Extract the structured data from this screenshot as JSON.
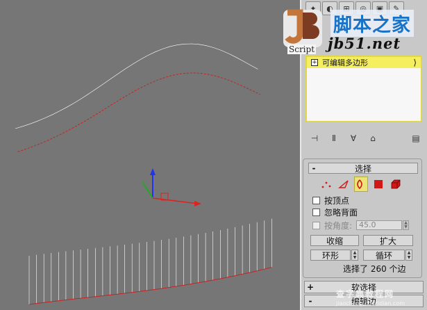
{
  "toolbar_tabs": [
    "create-icon",
    "modify-icon",
    "hierarchy-icon",
    "motion-icon",
    "display-icon",
    "utilities-icon"
  ],
  "logo": {
    "cn_text": "脚本之家",
    "url_text": "jb51.net",
    "script_text": "Script"
  },
  "modifier_stack": {
    "item_label": "可编辑多边形",
    "expand_symbol": "+"
  },
  "selection_rollout": {
    "title": "选择",
    "collapse_symbol": "-",
    "by_vertex_label": "按顶点",
    "ignore_backfacing_label": "忽略背面",
    "by_angle_label": "按角度:",
    "by_angle_value": "45.0",
    "shrink_label": "收缩",
    "grow_label": "扩大",
    "ring_label": "环形",
    "loop_label": "循环",
    "status_text": "选择了 260 个边"
  },
  "soft_selection_rollout": {
    "title": "软选择",
    "expand_symbol": "+"
  },
  "edit_edges_rollout": {
    "title": "编辑边",
    "collapse_symbol": "-"
  },
  "watermark": {
    "text": "查字典教程网",
    "sub_text": "jiaocheng.chazidian.com"
  },
  "colors": {
    "viewport_bg": "#767676",
    "wire": "#ffffff",
    "selected_edges": "#cc2020",
    "stack_highlight": "#f5ee5e",
    "panel_bg": "#c8c8c8"
  }
}
